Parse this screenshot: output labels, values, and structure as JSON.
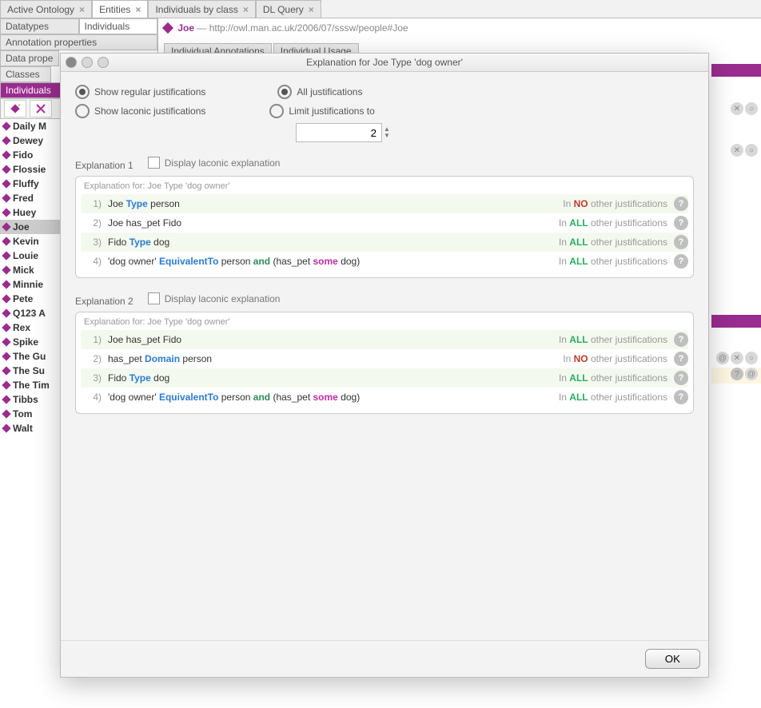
{
  "tabs": [
    {
      "label": "Active Ontology",
      "closable": true
    },
    {
      "label": "Entities",
      "closable": true,
      "active": true
    },
    {
      "label": "Individuals by class",
      "closable": true
    },
    {
      "label": "DL Query",
      "closable": true
    }
  ],
  "subtabs_left": [
    {
      "label": "Datatypes"
    },
    {
      "label": "Individuals",
      "active": true
    },
    {
      "label": "Annotation properties",
      "full": true
    },
    {
      "label": "Data prope",
      "full": false
    },
    {
      "label": "Classes"
    },
    {
      "label": "Individuals",
      "selected": true
    }
  ],
  "individuals": [
    "Daily M",
    "Dewey",
    "Fido",
    "Flossie",
    "Fluffy",
    "Fred",
    "Huey",
    "Joe",
    "Kevin",
    "Louie",
    "Mick",
    "Minnie",
    "Pete",
    "Q123 A",
    "Rex",
    "Spike",
    "The Gu",
    "The Su",
    "The Tim",
    "Tibbs",
    "Tom",
    "Walt"
  ],
  "selected_individual": "Joe",
  "entity_header": {
    "name": "Joe",
    "uri": "http://owl.man.ac.uk/2006/07/sssw/people#Joe"
  },
  "entity_subtabs": [
    "Individual Annotations",
    "Individual Usage"
  ],
  "dialog": {
    "title": "Explanation for Joe Type 'dog owner'",
    "radios": {
      "show_regular": "Show regular justifications",
      "show_laconic": "Show laconic justifications",
      "all": "All justifications",
      "limit": "Limit justifications to",
      "limit_value": "2"
    },
    "display_laconic": "Display laconic explanation",
    "exp_for": "Explanation for: Joe Type 'dog owner'",
    "in": "In",
    "other": "other justifications",
    "NO": "NO",
    "ALL": "ALL",
    "explanations": [
      {
        "title": "Explanation 1",
        "rows": [
          {
            "n": "1)",
            "axiom": [
              [
                "",
                "Joe "
              ],
              [
                "type",
                "Type"
              ],
              [
                "",
                " person"
              ]
            ],
            "just": "NO"
          },
          {
            "n": "2)",
            "axiom": [
              [
                "",
                "Joe has_pet Fido"
              ]
            ],
            "just": "ALL"
          },
          {
            "n": "3)",
            "axiom": [
              [
                "",
                "Fido "
              ],
              [
                "type",
                "Type"
              ],
              [
                "",
                " dog"
              ]
            ],
            "just": "ALL"
          },
          {
            "n": "4)",
            "axiom": [
              [
                "",
                "'dog owner' "
              ],
              [
                "eq",
                "EquivalentTo"
              ],
              [
                "",
                " person "
              ],
              [
                "and",
                "and"
              ],
              [
                "",
                " (has_pet "
              ],
              [
                "some",
                "some"
              ],
              [
                "",
                " dog)"
              ]
            ],
            "just": "ALL"
          }
        ]
      },
      {
        "title": "Explanation 2",
        "rows": [
          {
            "n": "1)",
            "axiom": [
              [
                "",
                "Joe has_pet Fido"
              ]
            ],
            "just": "ALL"
          },
          {
            "n": "2)",
            "axiom": [
              [
                "",
                "has_pet "
              ],
              [
                "type",
                "Domain"
              ],
              [
                "",
                " person"
              ]
            ],
            "just": "NO"
          },
          {
            "n": "3)",
            "axiom": [
              [
                "",
                "Fido "
              ],
              [
                "type",
                "Type"
              ],
              [
                "",
                " dog"
              ]
            ],
            "just": "ALL"
          },
          {
            "n": "4)",
            "axiom": [
              [
                "",
                "'dog owner' "
              ],
              [
                "eq",
                "EquivalentTo"
              ],
              [
                "",
                " person "
              ],
              [
                "and",
                "and"
              ],
              [
                "",
                " (has_pet "
              ],
              [
                "some",
                "some"
              ],
              [
                "",
                " dog)"
              ]
            ],
            "just": "ALL"
          }
        ]
      }
    ],
    "ok": "OK"
  }
}
